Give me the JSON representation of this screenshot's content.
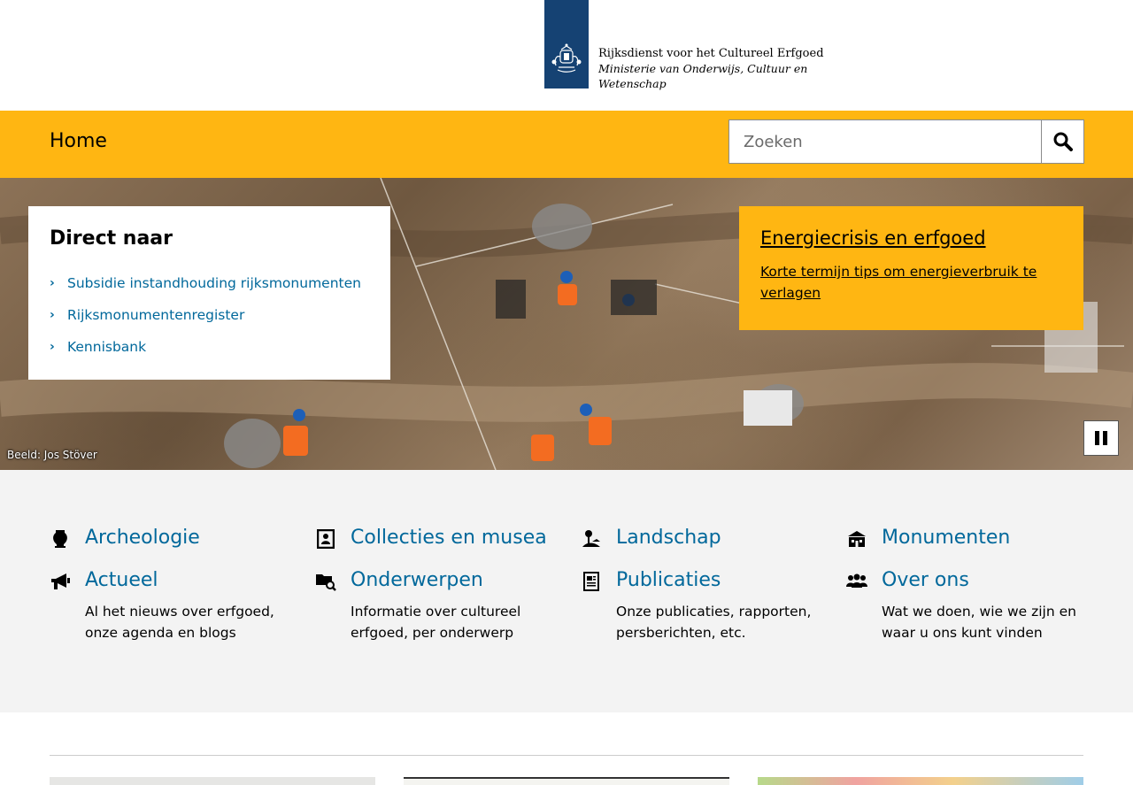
{
  "header": {
    "org_name": "Rijksdienst voor het Cultureel Erfgoed",
    "ministry": "Ministerie van Onderwijs, Cultuur en Wetenschap",
    "logo_icon": "rijksoverheid-emblem-icon"
  },
  "nav": {
    "home": "Home",
    "search_placeholder": "Zoeken",
    "search_icon": "search-icon"
  },
  "hero": {
    "direct": {
      "title": "Direct naar",
      "items": [
        "Subsidie instandhouding rijksmonumenten",
        "Rijksmonumentenregister",
        "Kennisbank"
      ]
    },
    "promo": {
      "title": "Energiecrisis en erfgoed",
      "link": "Korte termijn tips om energieverbruik te verlagen"
    },
    "credit": "Beeld: Jos Stöver",
    "pause_icon": "pause-icon"
  },
  "topics": [
    {
      "label": "Archeologie",
      "icon": "vase-icon",
      "desc": ""
    },
    {
      "label": "Collecties en musea",
      "icon": "frame-icon",
      "desc": ""
    },
    {
      "label": "Landschap",
      "icon": "landscape-icon",
      "desc": ""
    },
    {
      "label": "Monumenten",
      "icon": "building-icon",
      "desc": ""
    },
    {
      "label": "Actueel",
      "icon": "megaphone-icon",
      "desc": "Al het nieuws over erfgoed, onze agenda en blogs"
    },
    {
      "label": "Onderwerpen",
      "icon": "folder-search-icon",
      "desc": "Informatie over cultureel erfgoed, per onderwerp"
    },
    {
      "label": "Publicaties",
      "icon": "document-icon",
      "desc": "Onze publicaties, rapporten, persberichten, etc."
    },
    {
      "label": "Over ons",
      "icon": "people-icon",
      "desc": "Wat we doen, wie we zijn en waar u ons kunt vinden"
    }
  ],
  "colors": {
    "brand_yellow": "#ffb612",
    "link_blue": "#01689b",
    "logo_blue": "#154273",
    "section_grey": "#f3f3f3"
  }
}
